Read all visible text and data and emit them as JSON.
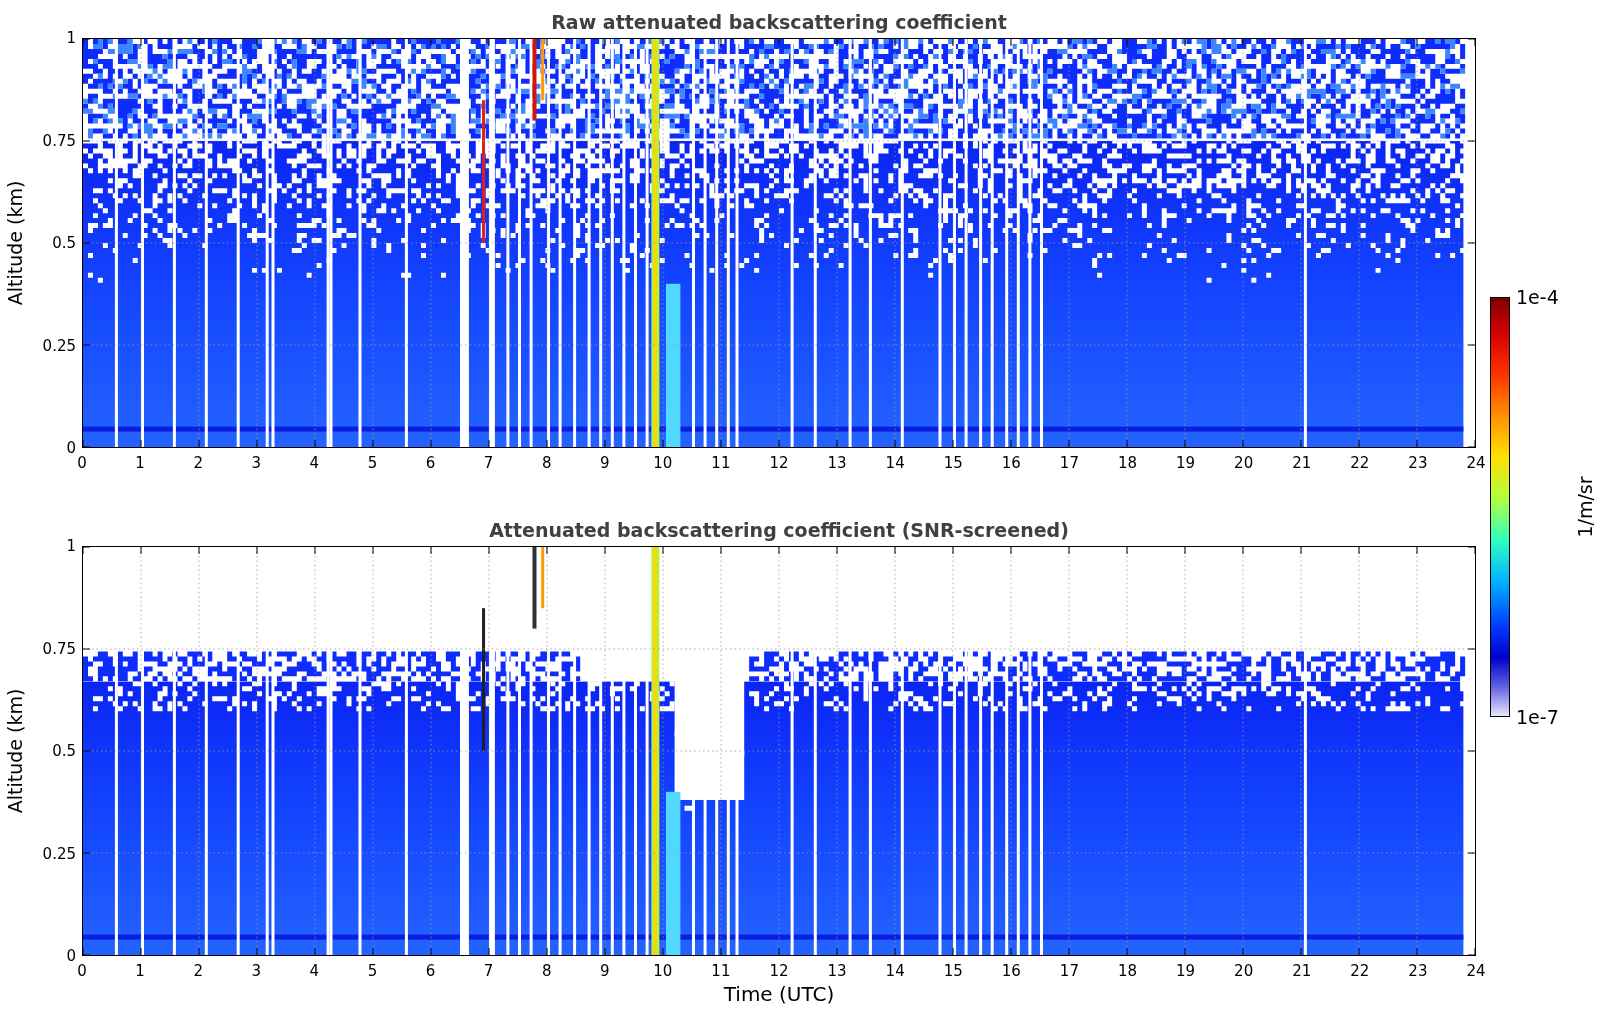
{
  "panels": [
    {
      "kind": "raw",
      "title": "Raw attenuated backscattering coefficient",
      "ylabel": "Altitude (km)",
      "yticks": [
        "1",
        "0.75",
        "0.5",
        "0.25",
        "0"
      ],
      "xticks": [
        "0",
        "1",
        "2",
        "3",
        "4",
        "5",
        "6",
        "7",
        "8",
        "9",
        "10",
        "11",
        "12",
        "13",
        "14",
        "15",
        "16",
        "17",
        "18",
        "19",
        "20",
        "21",
        "22",
        "23",
        "24"
      ]
    },
    {
      "kind": "screened",
      "title": "Attenuated backscattering coefficient (SNR-screened)",
      "ylabel": "Altitude (km)",
      "yticks": [
        "1",
        "0.75",
        "0.5",
        "0.25",
        "0"
      ],
      "xticks": [
        "0",
        "1",
        "2",
        "3",
        "4",
        "5",
        "6",
        "7",
        "8",
        "9",
        "10",
        "11",
        "12",
        "13",
        "14",
        "15",
        "16",
        "17",
        "18",
        "19",
        "20",
        "21",
        "22",
        "23",
        "24"
      ]
    }
  ],
  "xlabel": "Time (UTC)",
  "colorbar": {
    "max_label": "1e-4",
    "min_label": "1e-7",
    "label": "1/m/sr"
  }
}
